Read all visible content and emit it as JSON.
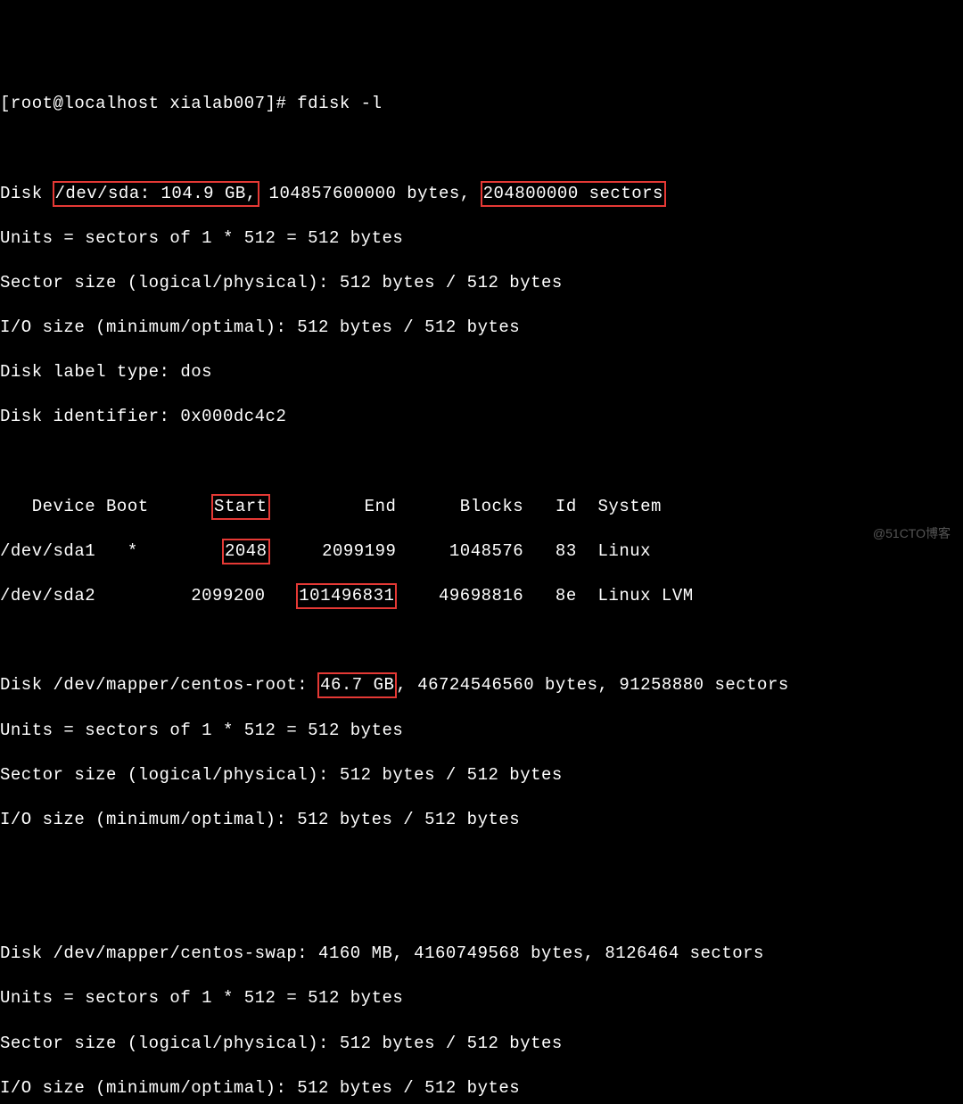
{
  "prompt": {
    "user_host": "[root@localhost xialab007]# ",
    "command": "fdisk -l"
  },
  "disk_sda": {
    "prefix": "Disk ",
    "dev_size": "/dev/sda: 104.9 GB,",
    "bytes": " 104857600000 bytes, ",
    "sectors": "204800000 sectors",
    "units": "Units = sectors of 1 * 512 = 512 bytes",
    "sector_size": "Sector size (logical/physical): 512 bytes / 512 bytes",
    "io_size": "I/O size (minimum/optimal): 512 bytes / 512 bytes",
    "label_type": "Disk label type: dos",
    "identifier": "Disk identifier: 0x000dc4c2"
  },
  "partition_table": {
    "header": {
      "prefix": "   Device Boot      ",
      "start": "Start",
      "rest": "         End      Blocks   Id  System"
    },
    "rows": [
      {
        "prefix": "/dev/sda1   *        ",
        "start": "2048",
        "mid": "     2099199     1048576   83  Linux"
      },
      {
        "prefix": "/dev/sda2         2099200   ",
        "end": "101496831",
        "rest": "    49698816   8e  Linux LVM"
      }
    ]
  },
  "disk_root": {
    "prefix": "Disk /dev/mapper/centos-root: ",
    "size": "46.7 GB",
    "rest": ", 46724546560 bytes, 91258880 sectors",
    "units": "Units = sectors of 1 * 512 = 512 bytes",
    "sector_size": "Sector size (logical/physical): 512 bytes / 512 bytes",
    "io_size": "I/O size (minimum/optimal): 512 bytes / 512 bytes"
  },
  "disk_swap": {
    "line": "Disk /dev/mapper/centos-swap: 4160 MB, 4160749568 bytes, 8126464 sectors",
    "units": "Units = sectors of 1 * 512 = 512 bytes",
    "sector_size": "Sector size (logical/physical): 512 bytes / 512 bytes",
    "io_size": "I/O size (minimum/optimal): 512 bytes / 512 bytes"
  },
  "watermark": "@51CTO博客"
}
